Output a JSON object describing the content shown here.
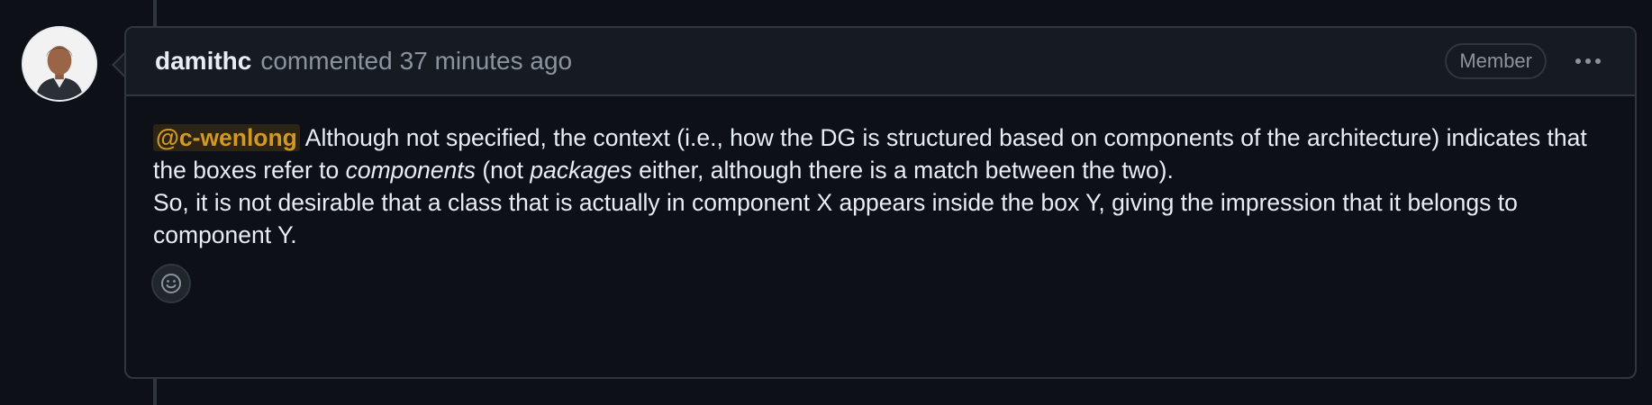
{
  "comment": {
    "author": "damithc",
    "action": "commented",
    "timestamp": "37 minutes ago",
    "badge": "Member",
    "mention": "@c-wenlong",
    "line1_after_mention": " Although not specified, the context (i.e., how the DG is structured based on components of the architecture) indicates that the boxes refer to ",
    "emph1": "components",
    "line1_mid": " (not ",
    "emph2": "packages",
    "line1_end": " either, although there is a match between the two).",
    "line2": "So, it is not desirable that a class that is actually in component X appears inside the box Y, giving the impression that it belongs to component Y."
  },
  "icons": {
    "avatar": "user-avatar",
    "more": "kebab-horizontal-icon",
    "reaction": "smiley-icon"
  },
  "colors": {
    "background": "#0d1117",
    "header_bg": "#161b22",
    "border": "#30363d",
    "mention": "#d29922",
    "muted": "#8b949e"
  }
}
